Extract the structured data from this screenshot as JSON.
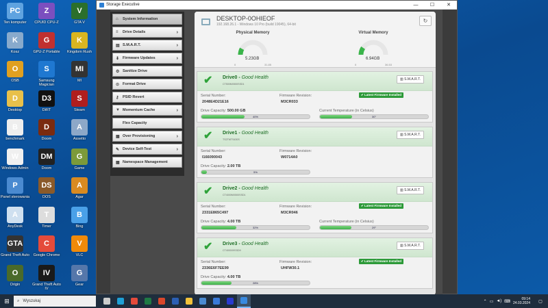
{
  "desktop": {
    "icons": [
      {
        "label": "Ten komputer",
        "color": "#5fa3e0",
        "glyph": "PC"
      },
      {
        "label": "CPUID CPU-Z",
        "color": "#7b4fbf",
        "glyph": "Z"
      },
      {
        "label": "GTA V",
        "color": "#2b6f2b",
        "glyph": "V"
      },
      {
        "label": "Kosz",
        "color": "#88aacc",
        "glyph": "K"
      },
      {
        "label": "GPU-Z Portable",
        "color": "#c03030",
        "glyph": "G"
      },
      {
        "label": "Kingdom Rush",
        "color": "#d9b520",
        "glyph": "K"
      },
      {
        "label": "OSB",
        "color": "#e0a020",
        "glyph": "O"
      },
      {
        "label": "Samsung Magician",
        "color": "#1f78d1",
        "glyph": "S"
      },
      {
        "label": "MI",
        "color": "#333333",
        "glyph": "MI"
      },
      {
        "label": "Desktop",
        "color": "#e8c04a",
        "glyph": "D"
      },
      {
        "label": "DiRT",
        "color": "#111111",
        "glyph": "D3"
      },
      {
        "label": "Steam",
        "color": "#b01e1e",
        "glyph": "S"
      },
      {
        "label": "benchmark",
        "color": "#eeeeee",
        "glyph": "B"
      },
      {
        "label": "Doom",
        "color": "#7a2b10",
        "glyph": "D"
      },
      {
        "label": "Assetto",
        "color": "#8da8c8",
        "glyph": "A"
      },
      {
        "label": "Windows Admin",
        "color": "#f0f0f0",
        "glyph": "W"
      },
      {
        "label": "Doom",
        "color": "#222222",
        "glyph": "DM"
      },
      {
        "label": "Game",
        "color": "#7c9a3a",
        "glyph": "G"
      },
      {
        "label": "Panel sterowania",
        "color": "#4a8ad0",
        "glyph": "P"
      },
      {
        "label": "DOS",
        "color": "#8a5a2a",
        "glyph": "DS"
      },
      {
        "label": "Agar",
        "color": "#d98a20",
        "glyph": "A"
      },
      {
        "label": "AnyDesk",
        "color": "#cfe0f0",
        "glyph": "A"
      },
      {
        "label": "Timer",
        "color": "#dddddd",
        "glyph": "T"
      },
      {
        "label": "Bing",
        "color": "#4aa0e8",
        "glyph": "B"
      },
      {
        "label": "Grand Theft Auto",
        "color": "#333333",
        "glyph": "GTA"
      },
      {
        "label": "Google Chrome",
        "color": "#e44b3b",
        "glyph": "C"
      },
      {
        "label": "VLC",
        "color": "#f08a0a",
        "glyph": "V"
      },
      {
        "label": "Origin",
        "color": "#4a6a2a",
        "glyph": "O"
      },
      {
        "label": "Grand Theft Auto IV",
        "color": "#1a1a1a",
        "glyph": "IV"
      },
      {
        "label": "Gear",
        "color": "#5577aa",
        "glyph": "G"
      }
    ]
  },
  "window": {
    "title": "Storage Executive",
    "minimize": "—",
    "maximize": "☐",
    "close": "✕"
  },
  "sidebar": {
    "items": [
      {
        "label": "System Information",
        "icon": "home-icon",
        "glyph": "⌂",
        "chevron": ""
      },
      {
        "label": "Drive Details",
        "icon": "list-icon",
        "glyph": "≡",
        "chevron": "›"
      },
      {
        "label": "S.M.A.R.T.",
        "icon": "chart-icon",
        "glyph": "▤",
        "chevron": "›"
      },
      {
        "label": "Firmware Updates",
        "icon": "download-icon",
        "glyph": "⬇",
        "chevron": "›"
      },
      {
        "label": "Sanitize Drive",
        "icon": "gear-icon",
        "glyph": "⚙",
        "chevron": ""
      },
      {
        "label": "Format Drive",
        "icon": "format-icon",
        "glyph": "⊙",
        "chevron": ""
      },
      {
        "label": "PSID Revert",
        "icon": "key-icon",
        "glyph": "⚷",
        "chevron": ""
      },
      {
        "label": "Momentum Cache",
        "icon": "filter-icon",
        "glyph": "▼",
        "chevron": "›"
      },
      {
        "label": "Flex Capacity",
        "icon": "flex-icon",
        "glyph": "",
        "chevron": ""
      },
      {
        "label": "Over Provisioning",
        "icon": "grid-icon",
        "glyph": "▦",
        "chevron": "›"
      },
      {
        "label": "Device Self-Test",
        "icon": "wrench-icon",
        "glyph": "✎",
        "chevron": "›"
      },
      {
        "label": "Namespace Management",
        "icon": "namespace-icon",
        "glyph": "▦",
        "chevron": ""
      }
    ]
  },
  "system": {
    "hostname": "DESKTOP-0OHIEOF",
    "subtitle": "192.168.26.1 - Windows 10 Pro (build 19045), 64-bit",
    "physical": {
      "title": "Physical Memory",
      "value": "5.23GB",
      "min": "0",
      "max": "31.85",
      "fraction": 0.16
    },
    "virtual": {
      "title": "Virtual Memory",
      "value": "6.94GB",
      "min": "0",
      "max": "36.53",
      "fraction": 0.19
    }
  },
  "labels": {
    "serial": "Serial Number:",
    "firmware": "Firmware Revision:",
    "capacity": "Drive Capacity:",
    "temperature": "Current Temperature (in Celsius)",
    "smart": "S.M.A.R.T.",
    "latest_fw": "✔ Latest Firmware Installed",
    "health_sep": " - "
  },
  "drives": [
    {
      "name": "Drive0",
      "health": "Good Health",
      "model": "CT500MX500SSD1",
      "serial": "2048E4D21E16",
      "firmware": "M3CR033",
      "capacity": "500.00 GB",
      "used_pct": 40,
      "used_text": "40%",
      "temp": 30,
      "temp_text": "30°",
      "latest_fw": true,
      "show_temp": true
    },
    {
      "name": "Drive1",
      "health": "Good Health",
      "model": "TS2TMTS430S",
      "serial": "I166090043",
      "firmware": "W0714A0",
      "capacity": "2.00 TB",
      "used_pct": 5,
      "used_text": "5%",
      "temp": null,
      "temp_text": "",
      "latest_fw": false,
      "show_temp": false
    },
    {
      "name": "Drive2",
      "health": "Good Health",
      "model": "CT4000MX500SSD1",
      "serial": "2331E865C497",
      "firmware": "M3CR046",
      "capacity": "4.00 TB",
      "used_pct": 32,
      "used_text": "32%",
      "temp": 29,
      "temp_text": "29°",
      "latest_fw": true,
      "show_temp": true
    },
    {
      "name": "Drive3",
      "health": "Good Health",
      "model": "CT4000X9SSD9",
      "serial": "2336E6F7EE99",
      "firmware": "UHFW30.1",
      "capacity": "4.00 TB",
      "used_pct": 28,
      "used_text": "28%",
      "temp": null,
      "temp_text": "",
      "latest_fw": true,
      "show_temp": false
    }
  ],
  "taskbar": {
    "search_placeholder": "Wyszukaj",
    "apps": [
      {
        "name": "task-view",
        "color": "#cccccc"
      },
      {
        "name": "edge",
        "color": "#1ea0d6"
      },
      {
        "name": "chrome",
        "color": "#e44b3b"
      },
      {
        "name": "excel",
        "color": "#1f7a44"
      },
      {
        "name": "office",
        "color": "#d9472b"
      },
      {
        "name": "word",
        "color": "#2b5fb4"
      },
      {
        "name": "explorer",
        "color": "#f2c23a"
      },
      {
        "name": "store",
        "color": "#4a8ad0"
      },
      {
        "name": "mail",
        "color": "#3a7ad8"
      },
      {
        "name": "app-blue",
        "color": "#2a3ad0"
      },
      {
        "name": "storage-executive",
        "color": "#3a8ae0"
      }
    ],
    "time": "09:14",
    "date": "24.03.2024"
  }
}
